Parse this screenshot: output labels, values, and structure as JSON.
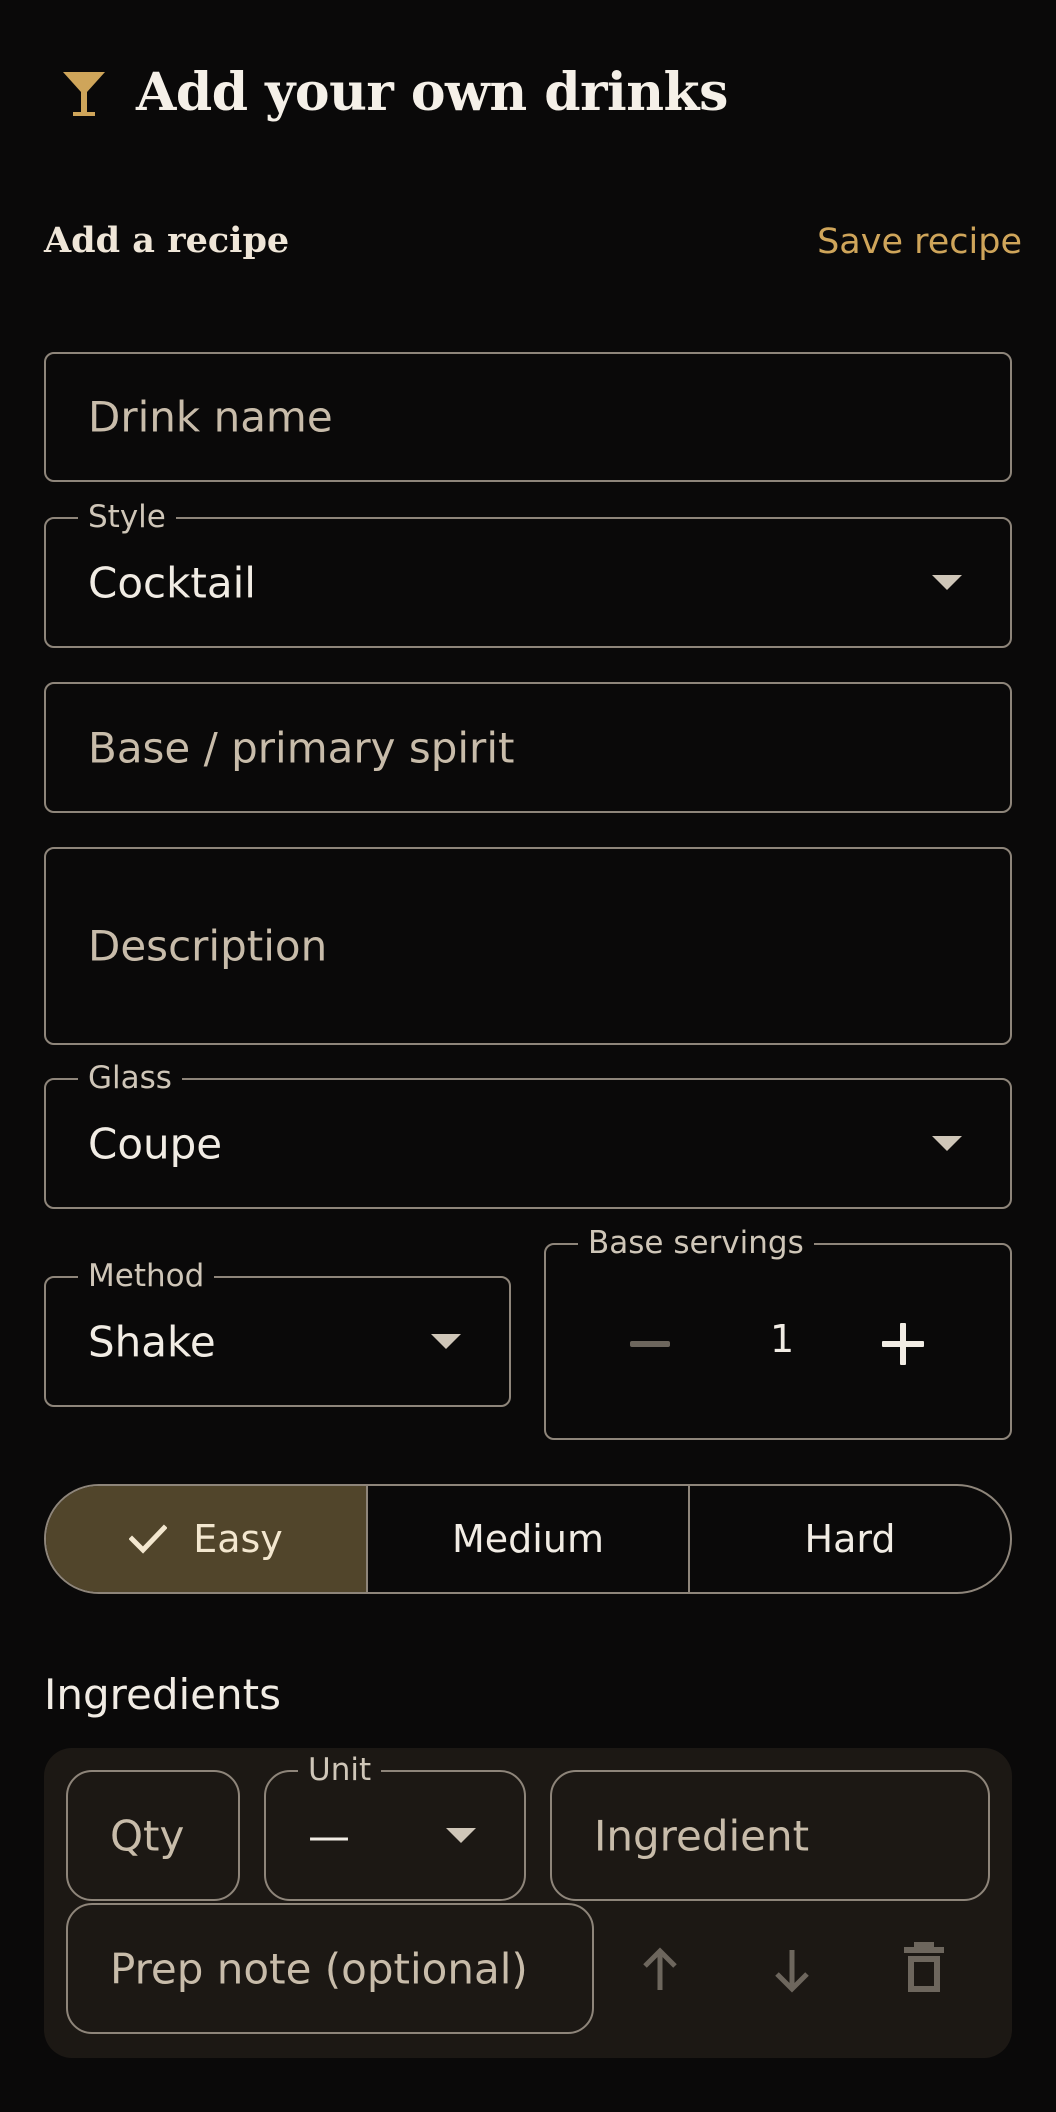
{
  "header": {
    "title": "Add your own drinks",
    "icon": "cocktail-glass-icon"
  },
  "section": {
    "title": "Add a recipe",
    "save_label": "Save recipe"
  },
  "form": {
    "drink_name_placeholder": "Drink name",
    "style": {
      "label": "Style",
      "value": "Cocktail"
    },
    "base_spirit_placeholder": "Base / primary spirit",
    "description_placeholder": "Description",
    "glass": {
      "label": "Glass",
      "value": "Coupe"
    },
    "method": {
      "label": "Method",
      "value": "Shake"
    },
    "servings": {
      "label": "Base servings",
      "value": "1"
    }
  },
  "difficulty": {
    "options": [
      "Easy",
      "Medium",
      "Hard"
    ],
    "selected": "Easy"
  },
  "ingredients": {
    "heading": "Ingredients",
    "row": {
      "qty_placeholder": "Qty",
      "unit_label": "Unit",
      "unit_value": "—",
      "ingredient_placeholder": "Ingredient",
      "prep_placeholder": "Prep note (optional)"
    }
  },
  "colors": {
    "background": "#0a0909",
    "accent": "#cfa55a",
    "outline": "#8e857a",
    "selected_segment": "#51452b",
    "card": "#1c1814"
  }
}
